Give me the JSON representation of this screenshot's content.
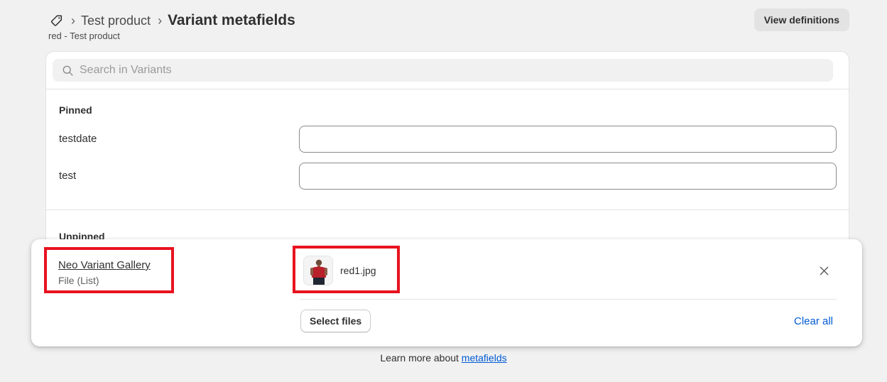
{
  "header": {
    "breadcrumb_parent": "Test product",
    "title": "Variant metafields",
    "subtitle": "red - Test product",
    "view_definitions_label": "View definitions"
  },
  "search": {
    "placeholder": "Search in Variants"
  },
  "pinned": {
    "title": "Pinned",
    "fields": [
      {
        "label": "testdate",
        "value": ""
      },
      {
        "label": "test",
        "value": ""
      }
    ]
  },
  "unpinned": {
    "title": "Unpinned",
    "metafield": {
      "name": "Neo Variant Gallery",
      "type": "File (List)",
      "file_name": "red1.jpg",
      "select_files_label": "Select files",
      "clear_all_label": "Clear all"
    }
  },
  "footer": {
    "text": "Learn more about ",
    "link": "metafields"
  },
  "icons": {
    "breadcrumb": "tag-icon",
    "search": "search-icon",
    "remove": "close-icon"
  },
  "colors": {
    "link": "#005bd3",
    "annotation": "#e8131f",
    "background": "#f1f1f1"
  }
}
